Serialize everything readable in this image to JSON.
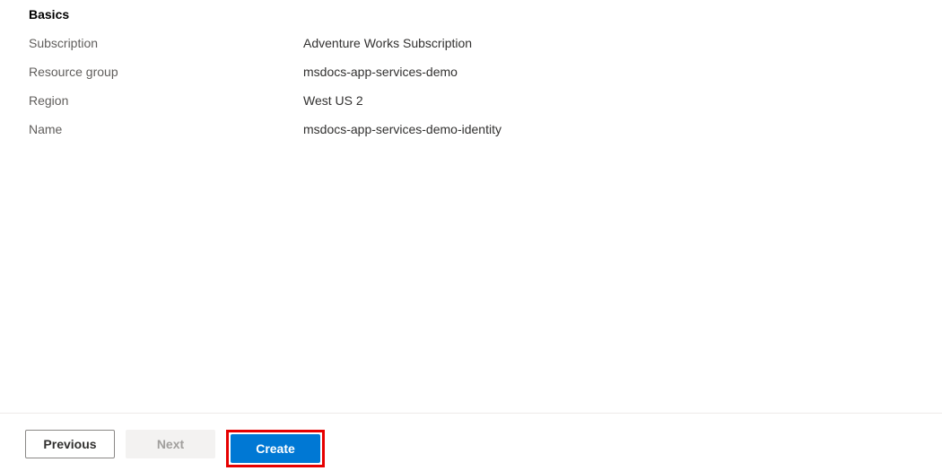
{
  "section": {
    "heading": "Basics",
    "rows": [
      {
        "label": "Subscription",
        "value": "Adventure Works Subscription"
      },
      {
        "label": "Resource group",
        "value": "msdocs-app-services-demo"
      },
      {
        "label": "Region",
        "value": "West US 2"
      },
      {
        "label": "Name",
        "value": "msdocs-app-services-demo-identity"
      }
    ]
  },
  "footer": {
    "previous_label": "Previous",
    "next_label": "Next",
    "create_label": "Create"
  }
}
